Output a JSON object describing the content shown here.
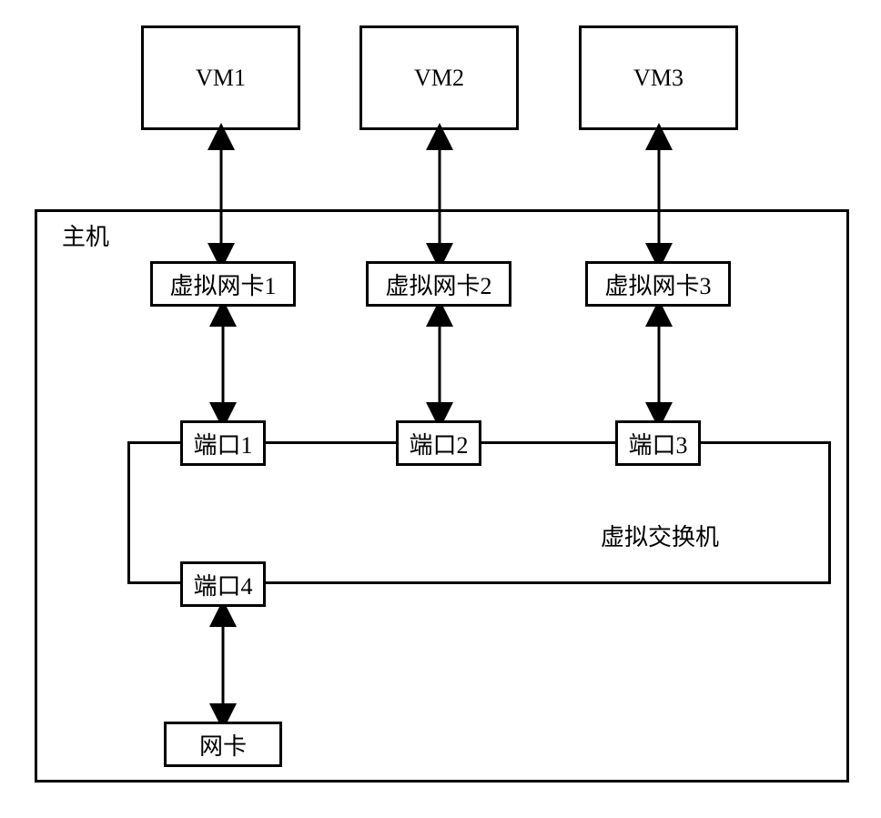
{
  "vms": {
    "vm1": "VM1",
    "vm2": "VM2",
    "vm3": "VM3"
  },
  "host_label": "主机",
  "vnics": {
    "v1": "虚拟网卡1",
    "v2": "虚拟网卡2",
    "v3": "虚拟网卡3"
  },
  "ports": {
    "p1": "端口1",
    "p2": "端口2",
    "p3": "端口3",
    "p4": "端口4"
  },
  "vswitch_label": "虚拟交换机",
  "nic_label": "网卡"
}
